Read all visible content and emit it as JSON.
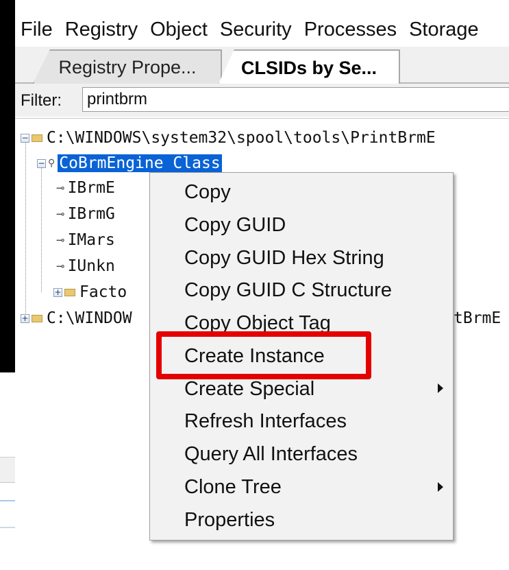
{
  "menubar": [
    "File",
    "Registry",
    "Object",
    "Security",
    "Processes",
    "Storage"
  ],
  "tabs": [
    {
      "label": "Registry Prope...",
      "active": false
    },
    {
      "label": "CLSIDs by Se...",
      "active": true
    }
  ],
  "filter": {
    "label": "Filter:",
    "value": "printbrm"
  },
  "tree": {
    "root1": "C:\\WINDOWS\\system32\\spool\\tools\\PrintBrmE",
    "class": "CoBrmEngine Class",
    "children": [
      "IBrmE",
      "IBrmG",
      "IMars",
      "IUnkn",
      "Facto"
    ],
    "root2": "C:\\WINDOW",
    "root2_tail": "tBrmE"
  },
  "context_menu": {
    "items": [
      {
        "label": "Copy",
        "submenu": false
      },
      {
        "label": "Copy GUID",
        "submenu": false
      },
      {
        "label": "Copy GUID Hex String",
        "submenu": false
      },
      {
        "label": "Copy GUID C Structure",
        "submenu": false
      },
      {
        "label": "Copy Object Tag",
        "submenu": false
      },
      {
        "label": "Create Instance",
        "submenu": false,
        "highlighted": true
      },
      {
        "label": "Create Special",
        "submenu": true
      },
      {
        "label": "Refresh Interfaces",
        "submenu": false
      },
      {
        "label": "Query All Interfaces",
        "submenu": false
      },
      {
        "label": "Clone Tree",
        "submenu": true
      },
      {
        "label": "Properties",
        "submenu": false
      }
    ]
  },
  "colors": {
    "selection": "#0a63d6",
    "highlight_box": "#e50000"
  }
}
